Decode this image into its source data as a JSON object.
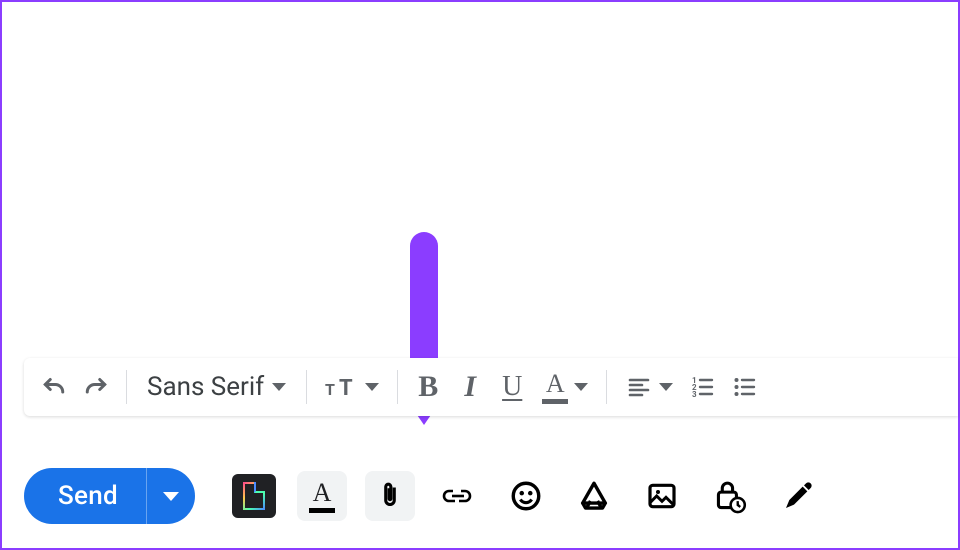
{
  "compose_body": "",
  "format_toolbar": {
    "font_family": "Sans Serif",
    "bold": "B",
    "italic": "I",
    "underline": "U",
    "text_color_letter": "A"
  },
  "action_bar": {
    "send_label": "Send",
    "text_color_letter": "A"
  },
  "annotation": {
    "target": "attach-file"
  },
  "colors": {
    "accent": "#8b3dff",
    "primary": "#1a73e8"
  }
}
